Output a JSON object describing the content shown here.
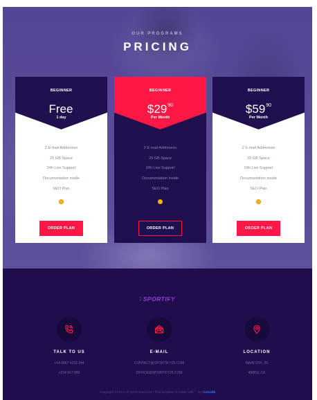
{
  "section": {
    "kicker": "OUR PROGRAMS",
    "title": "PRICING"
  },
  "plans": [
    {
      "tier": "BEGINNER",
      "price": "Free",
      "cents": "",
      "period": "1 day",
      "features": [
        "2 E-mail Addresess",
        "25 GB Space",
        "24h Live Support",
        "Documentation inside",
        "SEO Plan"
      ],
      "button": "ORDER PLAN"
    },
    {
      "tier": "BEGINNER",
      "price": "$29",
      "cents": "90",
      "period": "Per Month",
      "features": [
        "2 E-mail Addresess",
        "25 GB Space",
        "24h Live Support",
        "Documentation inside",
        "SEO Plan"
      ],
      "button": "ORDER PLAN"
    },
    {
      "tier": "BEGINNER",
      "price": "$59",
      "cents": "90",
      "period": "Per Month",
      "features": [
        "2 E-mail Addresess",
        "25 GB Space",
        "24h Live Support",
        "Documentation inside",
        "SEO Plan"
      ],
      "button": "ORDER PLAN"
    }
  ],
  "footer": {
    "logo": "SPORTIFY",
    "columns": [
      {
        "icon": "phone-icon",
        "label": "TALK TO US",
        "lines": [
          "+54 5667 4332 244",
          "+234 667 889"
        ]
      },
      {
        "icon": "envelope-icon",
        "label": "E-MAIL",
        "lines": [
          "CONTACT@SPORTIFY25.COM",
          "OFFICE@SPORTIFY25.COM"
        ]
      },
      {
        "icon": "location-pin-icon",
        "label": "LOCATION",
        "lines": [
          "MAIN STR. 25",
          "458811 CA"
        ]
      }
    ],
    "copyright": "Copyright ©2019 All rights reserved | This template is made with",
    "by": "by",
    "credit": "Colorlib"
  },
  "colors": {
    "accent": "#ff1845",
    "navy": "#200f4e",
    "footer_bg": "#1f0d4e",
    "hero_bg": "#574a98",
    "coin": "#f3b51d"
  }
}
